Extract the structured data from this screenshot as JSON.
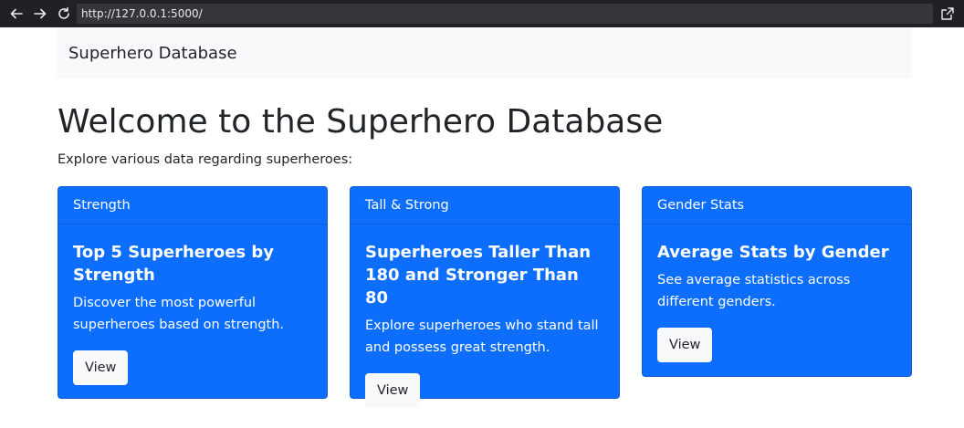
{
  "browser": {
    "url": "http://127.0.0.1:5000/"
  },
  "navbar": {
    "brand": "Superhero Database"
  },
  "main": {
    "title": "Welcome to the Superhero Database",
    "lead": "Explore various data regarding superheroes:"
  },
  "cards": [
    {
      "header": "Strength",
      "title": "Top 5 Superheroes by Strength",
      "text": "Discover the most powerful superheroes based on strength.",
      "button": "View"
    },
    {
      "header": "Tall & Strong",
      "title": "Superheroes Taller Than 180 and Stronger Than 80",
      "text": "Explore superheroes who stand tall and possess great strength.",
      "button": "View"
    },
    {
      "header": "Gender Stats",
      "title": "Average Stats by Gender",
      "text": "See average statistics across different genders.",
      "button": "View"
    }
  ],
  "colors": {
    "primary": "#0d6efd",
    "navbar_bg": "#f8f9fa",
    "button_bg": "#f8f9fa"
  }
}
